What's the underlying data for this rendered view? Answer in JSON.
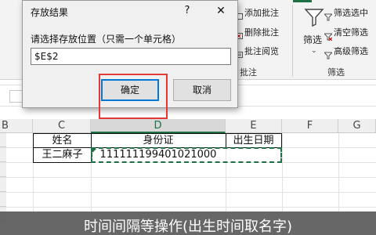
{
  "dialog": {
    "title": "存放结果",
    "help_icon": "?",
    "close_icon": "✕",
    "prompt": "请选择存放位置（只需一个单元格）",
    "input_value": "$E$2",
    "ok_label": "确定",
    "cancel_label": "取消"
  },
  "ribbon": {
    "add_comment": "添加批注",
    "delete_comment": "删除批注",
    "comment_reading": "批注阅览",
    "comment_group": "批注",
    "filter_label": "筛选",
    "filter_select": "筛选选中",
    "clear_filter": "清空筛选",
    "advanced_filter": "高级筛选",
    "filter_group": "筛选"
  },
  "sheet": {
    "columns": [
      "B",
      "C",
      "D",
      "E",
      "F",
      "G"
    ],
    "header_row": {
      "name": "姓名",
      "id": "身份证",
      "birth": "出生日期"
    },
    "row2": {
      "name": "王二麻子",
      "id": "111111199401021000",
      "birth": ""
    }
  },
  "caption": "时间间隔等操作(出生时间取名字)",
  "colors": {
    "accent": "#1e7145",
    "highlight": "#e53935",
    "focus": "#0078d7"
  }
}
